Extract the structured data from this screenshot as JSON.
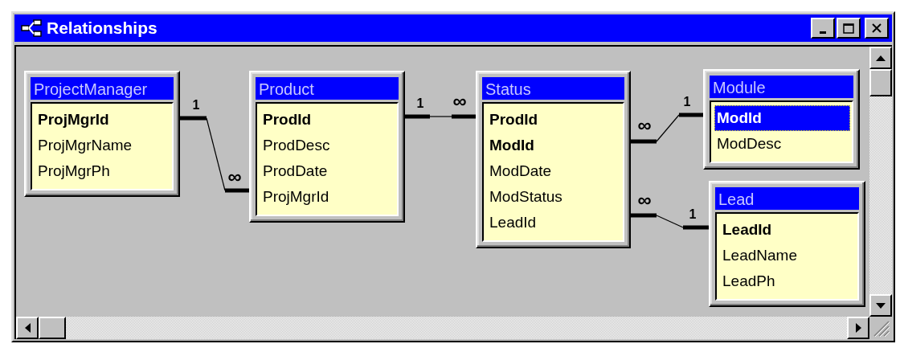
{
  "window": {
    "title": "Relationships"
  },
  "tables": [
    {
      "name": "ProjectManager",
      "fields": [
        {
          "name": "ProjMgrId",
          "primary_key": true,
          "selected": false
        },
        {
          "name": "ProjMgrName",
          "primary_key": false,
          "selected": false
        },
        {
          "name": "ProjMgrPh",
          "primary_key": false,
          "selected": false
        }
      ]
    },
    {
      "name": "Product",
      "fields": [
        {
          "name": "ProdId",
          "primary_key": true,
          "selected": false
        },
        {
          "name": "ProdDesc",
          "primary_key": false,
          "selected": false
        },
        {
          "name": "ProdDate",
          "primary_key": false,
          "selected": false
        },
        {
          "name": "ProjMgrId",
          "primary_key": false,
          "selected": false
        }
      ]
    },
    {
      "name": "Status",
      "fields": [
        {
          "name": "ProdId",
          "primary_key": true,
          "selected": false
        },
        {
          "name": "ModId",
          "primary_key": true,
          "selected": false
        },
        {
          "name": "ModDate",
          "primary_key": false,
          "selected": false
        },
        {
          "name": "ModStatus",
          "primary_key": false,
          "selected": false
        },
        {
          "name": "LeadId",
          "primary_key": false,
          "selected": false
        }
      ]
    },
    {
      "name": "Module",
      "fields": [
        {
          "name": "ModId",
          "primary_key": true,
          "selected": true
        },
        {
          "name": "ModDesc",
          "primary_key": false,
          "selected": false
        }
      ]
    },
    {
      "name": "Lead",
      "fields": [
        {
          "name": "LeadId",
          "primary_key": true,
          "selected": false
        },
        {
          "name": "LeadName",
          "primary_key": false,
          "selected": false
        },
        {
          "name": "LeadPh",
          "primary_key": false,
          "selected": false
        }
      ]
    }
  ],
  "relationships": [
    {
      "one_label": "1",
      "many_label": "∞"
    },
    {
      "one_label": "1",
      "many_label": "∞"
    },
    {
      "one_label": "1",
      "many_label": "∞"
    },
    {
      "one_label": "1",
      "many_label": "∞"
    }
  ]
}
